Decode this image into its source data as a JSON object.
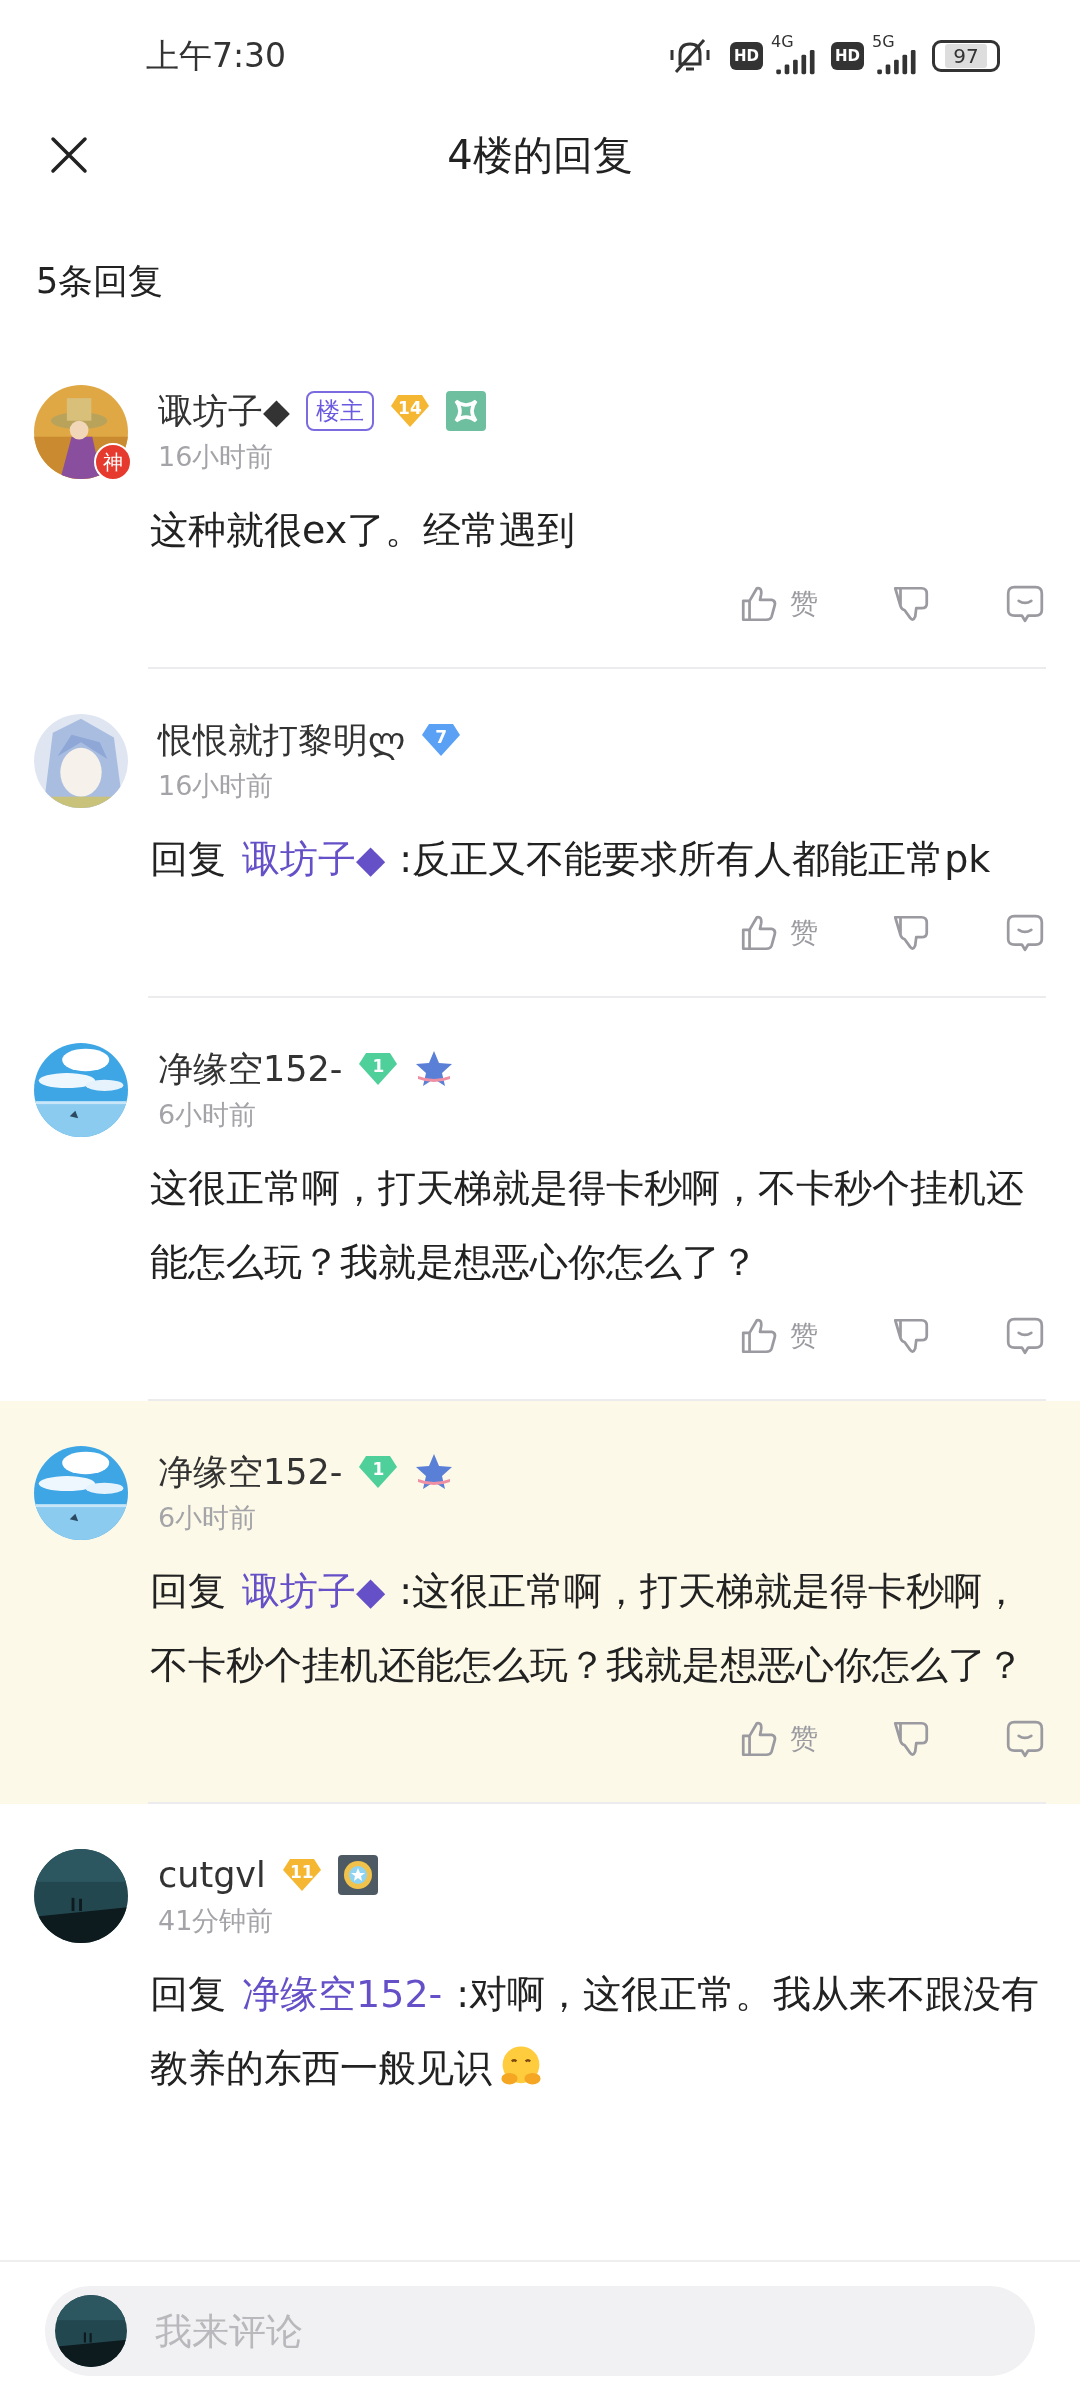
{
  "status_bar": {
    "time": "上午7:30",
    "networks": [
      {
        "hd": "HD",
        "type": "4G"
      },
      {
        "hd": "HD",
        "type": "5G"
      }
    ],
    "battery": "97"
  },
  "header": {
    "title": "4楼的回复"
  },
  "reply_count": "5条回复",
  "comments": [
    {
      "name": "诹坊子◆",
      "avatar": {
        "kind": "picture",
        "badge": "神"
      },
      "badges": [
        {
          "kind": "host",
          "text": "楼主"
        },
        {
          "kind": "level",
          "text": "14",
          "color": "#f5b731"
        },
        {
          "kind": "square-medal"
        }
      ],
      "time": "16小时前",
      "text": "这种就很ex了。经常遇到",
      "highlighted": false,
      "like": "赞"
    },
    {
      "name": "恨恨就打黎明ლ",
      "avatar": {
        "kind": "picture"
      },
      "badges": [
        {
          "kind": "level",
          "text": "7",
          "color": "#5aa0f5"
        }
      ],
      "time": "16小时前",
      "reply_prefix": "回复",
      "reply_to": "诹坊子◆",
      "text": ":反正又不能要求所有人都能正常pk",
      "highlighted": false,
      "like": "赞"
    },
    {
      "name": "净缘空152-",
      "avatar": {
        "kind": "picture"
      },
      "badges": [
        {
          "kind": "level",
          "text": "1",
          "color": "#4fcf9a"
        },
        {
          "kind": "star-medal"
        }
      ],
      "time": "6小时前",
      "text": "这很正常啊，打天梯就是得卡秒啊，不卡秒个挂机还能怎么玩？我就是想恶心你怎么了？",
      "highlighted": false,
      "like": "赞"
    },
    {
      "name": "净缘空152-",
      "avatar": {
        "kind": "picture"
      },
      "badges": [
        {
          "kind": "level",
          "text": "1",
          "color": "#4fcf9a"
        },
        {
          "kind": "star-medal"
        }
      ],
      "time": "6小时前",
      "reply_prefix": "回复",
      "reply_to": "诹坊子◆",
      "text": ":这很正常啊，打天梯就是得卡秒啊，不卡秒个挂机还能怎么玩？我就是想恶心你怎么了？",
      "highlighted": true,
      "like": "赞"
    },
    {
      "name": "cutgvl",
      "avatar": {
        "kind": "picture"
      },
      "badges": [
        {
          "kind": "level",
          "text": "11",
          "color": "#f5b731"
        },
        {
          "kind": "sun-medal"
        }
      ],
      "time": "41分钟前",
      "reply_prefix": "回复",
      "reply_to": "净缘空152-",
      "text": ":对啊，这很正常。我从来不跟没有教养的东西一般见识",
      "emoji": true,
      "highlighted": false
    }
  ],
  "comment_bar": {
    "avatar": {
      "kind": "picture"
    },
    "placeholder": "我来评论"
  }
}
